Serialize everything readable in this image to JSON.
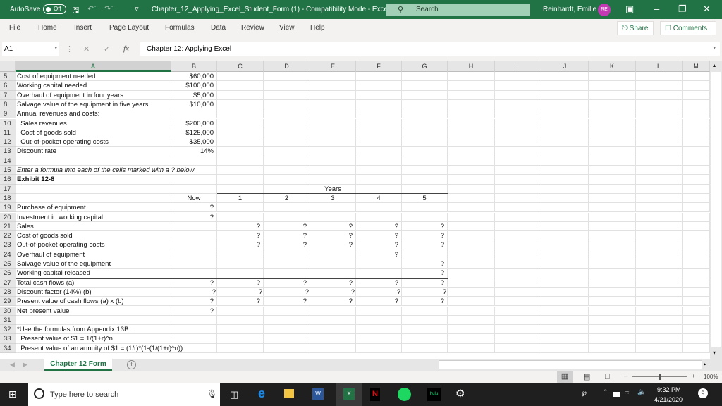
{
  "titlebar": {
    "autosave_label": "AutoSave",
    "autosave_state": "Off",
    "document_title": "Chapter_12_Applying_Excel_Student_Form (1)  -  Compatibility Mode  -  Excel",
    "search_placeholder": "Search",
    "user_name": "Reinhardt, Emilie",
    "user_initials": "RE",
    "icons": [
      "save-icon",
      "undo-icon",
      "redo-icon",
      "customize-qat-icon",
      "ribbon-display-icon",
      "minimize-icon",
      "restore-icon",
      "close-icon"
    ]
  },
  "ribbon": {
    "tabs": [
      "File",
      "Home",
      "Insert",
      "Page Layout",
      "Formulas",
      "Data",
      "Review",
      "View",
      "Help"
    ],
    "share_label": "Share",
    "comments_label": "Comments"
  },
  "formula_bar": {
    "name_box": "A1",
    "fx_label": "fx",
    "content": "Chapter 12: Applying Excel"
  },
  "columns": [
    "A",
    "B",
    "C",
    "D",
    "E",
    "F",
    "G",
    "H",
    "I",
    "J",
    "K",
    "L",
    "M"
  ],
  "rows": [
    {
      "n": "5",
      "A": "Cost of equipment needed",
      "B": "$60,000"
    },
    {
      "n": "6",
      "A": "Working capital needed",
      "B": "$100,000"
    },
    {
      "n": "7",
      "A": "Overhaul of equipment in four years",
      "B": "$5,000"
    },
    {
      "n": "8",
      "A": "Salvage value of the equipment in five years",
      "B": "$10,000"
    },
    {
      "n": "9",
      "A": "Annual revenues and costs:"
    },
    {
      "n": "10",
      "A": "  Sales revenues",
      "B": "$200,000"
    },
    {
      "n": "11",
      "A": "  Cost of goods sold",
      "B": "$125,000"
    },
    {
      "n": "12",
      "A": "  Out-of-pocket operating costs",
      "B": "$35,000"
    },
    {
      "n": "13",
      "A": "Discount rate",
      "B": "14%"
    },
    {
      "n": "14"
    },
    {
      "n": "15",
      "A": "Enter a formula into each of the cells marked with a ? below"
    },
    {
      "n": "16",
      "A": "Exhibit 12-8"
    },
    {
      "n": "17",
      "E": "Years"
    },
    {
      "n": "18",
      "B": "Now",
      "C": "1",
      "D": "2",
      "E": "3",
      "F": "4",
      "G": "5"
    },
    {
      "n": "19",
      "A": "Purchase of equipment",
      "B": "?"
    },
    {
      "n": "20",
      "A": "Investment in working capital",
      "B": "?"
    },
    {
      "n": "21",
      "A": "Sales",
      "C": "?",
      "D": "?",
      "E": "?",
      "F": "?",
      "G": "?"
    },
    {
      "n": "22",
      "A": "Cost of goods sold",
      "C": "?",
      "D": "?",
      "E": "?",
      "F": "?",
      "G": "?"
    },
    {
      "n": "23",
      "A": "Out-of-pocket operating costs",
      "C": "?",
      "D": "?",
      "E": "?",
      "F": "?",
      "G": "?"
    },
    {
      "n": "24",
      "A": "Overhaul of equipment",
      "F": "?"
    },
    {
      "n": "25",
      "A": "Salvage value of the equipment",
      "G": "?"
    },
    {
      "n": "26",
      "A": "Working capital released",
      "G": "?"
    },
    {
      "n": "27",
      "A": "Total cash flows (a)",
      "B": "?",
      "C": "?",
      "D": "?",
      "E": "?",
      "F": "?",
      "G": "?"
    },
    {
      "n": "28",
      "A": "Discount factor (14%) (b)",
      "B": "?",
      "C": "?",
      "D": "?",
      "E": "?",
      "F": "?",
      "G": "?"
    },
    {
      "n": "29",
      "A": "Present value of cash flows (a) x (b)",
      "B": "?",
      "C": "?",
      "D": "?",
      "E": "?",
      "F": "?",
      "G": "?"
    },
    {
      "n": "30",
      "A": "Net present value",
      "B": "?"
    },
    {
      "n": "31"
    },
    {
      "n": "32",
      "A": "*Use the formulas from Appendix 13B:"
    },
    {
      "n": "33",
      "A": "  Present value of $1 = 1/(1+r)^n"
    },
    {
      "n": "34",
      "A": "  Present value of an annuity of $1 = (1/r)*(1-(1/(1+r)^n))"
    }
  ],
  "sheet_tabs": {
    "active": "Chapter 12 Form",
    "add_label": "+"
  },
  "status_bar": {
    "zoom": "100%",
    "views": [
      "normal-view",
      "page-layout-view",
      "page-break-view"
    ]
  },
  "taskbar": {
    "search_placeholder": "Type here to search",
    "apps": [
      "task-view",
      "edge",
      "file-explorer",
      "word",
      "excel",
      "netflix",
      "spotify",
      "hulu",
      "settings"
    ],
    "hulu_label": "hulu",
    "time": "9:32 PM",
    "date": "4/21/2020",
    "notification_count": "9"
  },
  "colors": {
    "excel_green": "#217346",
    "avatar": "#c239b3",
    "taskbar": "#1f1f1f"
  }
}
